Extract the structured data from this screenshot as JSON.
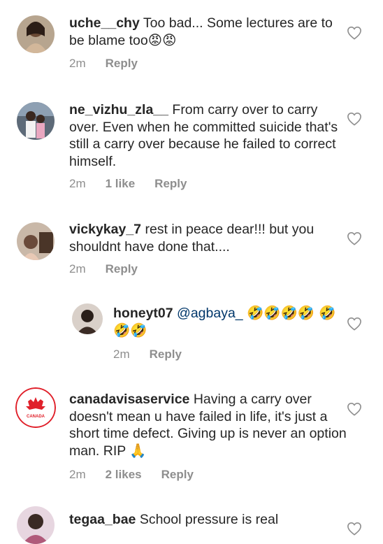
{
  "comments": [
    {
      "username": "uche__chy",
      "text": "Too bad... Some lectures are to be blame too",
      "emoji": "😡😡",
      "time": "2m",
      "likes": "",
      "reply": "Reply"
    },
    {
      "username": "ne_vizhu_zla__",
      "text": "From carry over to carry over. Even when he committed suicide that's still a carry over because he failed to correct himself.",
      "emoji": "",
      "time": "2m",
      "likes": "1 like",
      "reply": "Reply"
    },
    {
      "username": "vickykay_7",
      "text": "rest in peace dear!!! but you shouldnt have done that....",
      "emoji": "",
      "time": "2m",
      "likes": "",
      "reply": "Reply"
    },
    {
      "username": "honeyt07",
      "text": "@agbaya_",
      "emoji": "🤣🤣🤣🤣 🤣🤣🤣",
      "time": "2m",
      "likes": "",
      "reply": "Reply"
    },
    {
      "username": "canadavisaservice",
      "text": "Having a carry over doesn't mean u have failed in life, it's just a short time defect. Giving up is never an option man. RIP",
      "emoji": "🙏",
      "avatar_label": "CANADA",
      "time": "2m",
      "likes": "2 likes",
      "reply": "Reply"
    },
    {
      "username": "tegaa_bae",
      "text": "School pressure is real",
      "emoji": "",
      "time": "",
      "likes": "",
      "reply": ""
    }
  ],
  "colors": {
    "text": "#262626",
    "meta": "#8e8e8e",
    "heart": "#8e8e8e",
    "brand_red": "#e0202a"
  }
}
